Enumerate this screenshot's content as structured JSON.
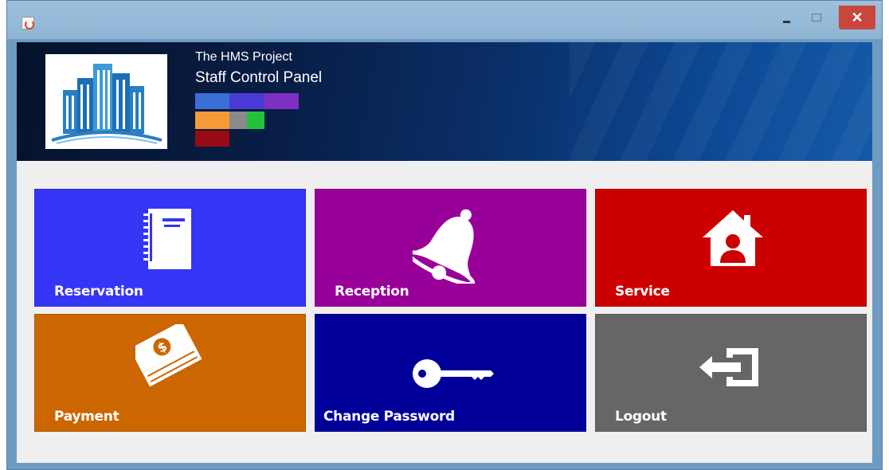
{
  "window": {
    "app_icon": "java-cup-icon",
    "controls": {
      "minimize": "–",
      "maximize": "☐",
      "close": "✕"
    }
  },
  "header": {
    "app_name": "The HMS Project",
    "panel_title": "Staff Control Panel",
    "logo_icon": "buildings-logo-icon",
    "swatches": [
      "#3b6fd8",
      "#4b3bd6",
      "#7e2fc4",
      "#f49a38",
      "#8a8a8a",
      "#22c33a",
      "#9a0a14"
    ]
  },
  "tiles": [
    {
      "label": "Reservation",
      "icon": "notebook-icon",
      "color": "#3535f5"
    },
    {
      "label": "Reception",
      "icon": "bell-icon",
      "color": "#990099"
    },
    {
      "label": "Service",
      "icon": "home-user-icon",
      "color": "#cc0000"
    },
    {
      "label": "Payment",
      "icon": "money-icon",
      "color": "#cc6600"
    },
    {
      "label": "Change Password",
      "icon": "key-icon",
      "color": "#000099"
    },
    {
      "label": "Logout",
      "icon": "logout-icon",
      "color": "#666666"
    }
  ]
}
